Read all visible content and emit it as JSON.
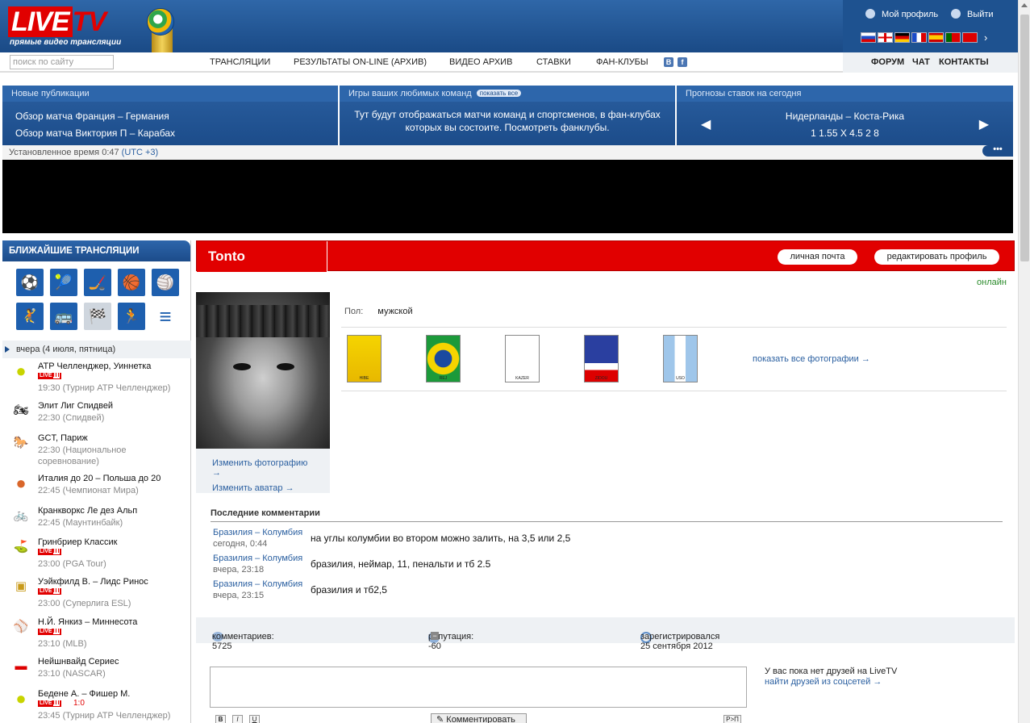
{
  "header": {
    "logo_word": "LIVE",
    "logo_tv": "TV",
    "logo_sub": "прямые видео трансляции",
    "my_profile": "Мой профиль",
    "logout": "Выйти",
    "flags": [
      "ru",
      "en",
      "de",
      "fr",
      "es",
      "pt",
      "tr"
    ]
  },
  "nav": {
    "search_placeholder": "поиск по сайту",
    "items": [
      "ТРАНСЛЯЦИИ",
      "РЕЗУЛЬТАТЫ ON-LINE  (АРХИВ)",
      "ВИДЕО АРХИВ",
      "СТАВКИ",
      "ФАН-КЛУБЫ"
    ],
    "social_vk": "B",
    "social_fb": "f",
    "right": [
      "ФОРУМ",
      "ЧАТ",
      "КОНТАКТЫ"
    ]
  },
  "panels": {
    "news_title": "Новые публикации",
    "news": [
      "Обзор матча Франция – Германия",
      "Обзор матча Виктория П – Карабах"
    ],
    "teams_title": "Игры ваших любимых команд",
    "teams_pill": "показать все",
    "teams_text": "Тут будут отображаться матчи команд и спортсменов, в фан-клубах которых вы состоите. Посмотреть фанклубы.",
    "bets_title": "Прогнозы ставок на сегодня",
    "bets_match": "Нидерланды – Коста-Рика",
    "bets_odds": "1 1.55    X 4.5    2 8"
  },
  "timebar": {
    "text": "Установленное время 0:47 ",
    "utc": "(UTC +3)",
    "more": "•••"
  },
  "sidebar": {
    "title": "БЛИЖАЙШИЕ ТРАНСЛЯЦИИ",
    "sports": [
      "football-icon",
      "tennis-icon",
      "hockey-icon",
      "basketball-icon",
      "volleyball-icon",
      "handball-icon",
      "bus-icon",
      "racing-icon",
      "runner-icon",
      "menu-icon"
    ],
    "day": "вчера (4 июля, пятница)",
    "live_label": "LIVE",
    "events": [
      {
        "icon": "tennis-ball-icon",
        "title": "ATP Челленджер, Уиннетка",
        "live": true,
        "score": "",
        "time": "19:30 (Турнир ATP Челленджер)"
      },
      {
        "icon": "speedway-icon",
        "title": "Элит Лиг Спидвей",
        "live": false,
        "score": "",
        "time": "22:30 (Спидвей)"
      },
      {
        "icon": "horse-icon",
        "title": "GCT, Париж",
        "live": false,
        "score": "",
        "time": "22:30 (Национальное соревнование)"
      },
      {
        "icon": "basketball-ball-icon",
        "title": "Италия до 20 – Польша до 20",
        "live": false,
        "score": "",
        "time": "22:45 (Чемпионат Мира)"
      },
      {
        "icon": "bike-icon",
        "title": "Кранкворкс Ле дез Альп",
        "live": false,
        "score": "",
        "time": "22:45 (Маунтинбайк)"
      },
      {
        "icon": "golf-icon",
        "title": "Гринбриер Классик",
        "live": true,
        "score": "",
        "time": "23:00 (PGA Tour)"
      },
      {
        "icon": "esl-icon",
        "title": "Уэйкфилд В. – Лидс Ринос",
        "live": true,
        "score": "",
        "time": "23:00 (Суперлига ESL)"
      },
      {
        "icon": "mlb-icon",
        "title": "Н.Й. Янкиз – Миннесота",
        "live": true,
        "score": "",
        "time": "23:10 (MLB)"
      },
      {
        "icon": "nascar-icon",
        "title": "Нейшнвайд Сериес",
        "live": false,
        "score": "",
        "time": "23:10 (NASCAR)"
      },
      {
        "icon": "tennis-ball-icon",
        "title": "Бедене А. – Фишер М.",
        "live": true,
        "score": "1:0",
        "time": "23:45 (Турнир ATP Челленджер)"
      }
    ]
  },
  "profile": {
    "name": "Tonto",
    "mail_button": "личная почта",
    "edit_button": "редактировать профиль",
    "status": "онлайн",
    "gender_label": "Пол:",
    "gender_value": "мужской",
    "change_photo": "Изменить фотографию →",
    "change_avatar": "Изменить аватар →",
    "photos": [
      "HIBE",
      "REJ",
      "KAZER",
      "ZIDOU",
      "USO"
    ],
    "show_photos": "показать все фотографии →",
    "comments_title": "Последние комментарии",
    "comments": [
      {
        "match": "Бразилия – Колумбия",
        "when": "сегодня, 0:44",
        "text": "на углы колумбии во втором можно залить, на 3,5 или 2,5"
      },
      {
        "match": "Бразилия – Колумбия",
        "when": "вчера, 23:18",
        "text": "бразилия, неймар, 11, пенальти и тб 2.5"
      },
      {
        "match": "Бразилия – Колумбия",
        "when": "вчера, 23:15",
        "text": "бразилия и тб2,5"
      }
    ],
    "stats": {
      "comments": "комментариев: 5725",
      "reputation": "репутация: -60",
      "registered": "зарегистрировался 25 сентября 2012"
    },
    "friends_text": "У вас пока нет друзей на LiveTV",
    "friends_link": "найти друзей из соцсетей →",
    "fmt": [
      "B",
      "I",
      "U"
    ],
    "submit": "Комментировать",
    "translit": "Р>П"
  }
}
